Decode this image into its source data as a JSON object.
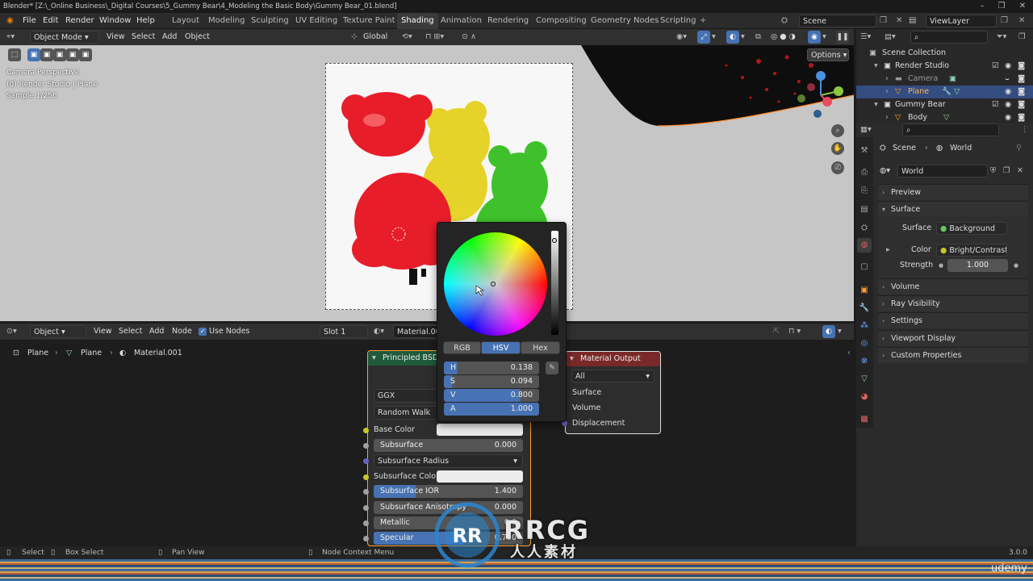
{
  "titlebar": {
    "text": "Blender* [Z:\\_Online Business\\_Digital Courses\\5_Gummy Bear\\4_Modeling the Basic Body\\Gummy Bear_01.blend]"
  },
  "menu": {
    "file": "File",
    "edit": "Edit",
    "render": "Render",
    "window": "Window",
    "help": "Help"
  },
  "workspaces": [
    "Layout",
    "Modeling",
    "Sculpting",
    "UV Editing",
    "Texture Paint",
    "Shading",
    "Animation",
    "Rendering",
    "Compositing",
    "Geometry Nodes",
    "Scripting"
  ],
  "scene": {
    "scene_name": "Scene",
    "view_layer": "ViewLayer"
  },
  "viewport_header": {
    "mode": "Object Mode",
    "view": "View",
    "select": "Select",
    "add": "Add",
    "object": "Object",
    "orientation": "Global",
    "options": "Options"
  },
  "viewport_overlay": {
    "line1": "Camera Perspective",
    "line2": "(0) Render Studio | Plane",
    "line3": "Sample 1/256"
  },
  "node_header": {
    "type": "Object",
    "view": "View",
    "select": "Select",
    "add": "Add",
    "node": "Node",
    "use_nodes": "Use Nodes",
    "slot": "Slot 1",
    "material": "Material.001"
  },
  "breadcrumb": {
    "obj": "Plane",
    "mesh": "Plane",
    "mat": "Material.001"
  },
  "bsdf": {
    "title": "Principled BSDF",
    "dist": "GGX",
    "sss": "Random Walk",
    "props": [
      {
        "label": "Base Color"
      },
      {
        "label": "Subsurface",
        "value": "0.000"
      },
      {
        "label": "Subsurface Radius"
      },
      {
        "label": "Subsurface Color"
      },
      {
        "label": "Subsurface IOR",
        "value": "1.400"
      },
      {
        "label": "Subsurface Anisotropy",
        "value": "0.000"
      },
      {
        "label": "Metallic",
        "value": "0.0"
      },
      {
        "label": "Specular",
        "value": "0.750"
      }
    ]
  },
  "output_node": {
    "title": "Material Output",
    "target": "All",
    "surface": "Surface",
    "volume": "Volume",
    "displacement": "Displacement"
  },
  "picker": {
    "tabs": [
      "RGB",
      "HSV",
      "Hex"
    ],
    "fields": [
      {
        "label": "H",
        "value": "0.138"
      },
      {
        "label": "S",
        "value": "0.094"
      },
      {
        "label": "V",
        "value": "0.800"
      },
      {
        "label": "A",
        "value": "1.000"
      }
    ]
  },
  "outliner": {
    "title": "Scene Collection",
    "items": [
      "Render Studio",
      "Camera",
      "Plane",
      "Gummy Bear",
      "Body"
    ]
  },
  "properties": {
    "scene": "Scene",
    "world": "World",
    "world_name": "World",
    "preview": "Preview",
    "surface": "Surface",
    "surface_label": "Surface",
    "surface_value": "Background",
    "color_label": "Color",
    "color_value": "Bright/Contrast",
    "strength_label": "Strength",
    "strength_value": "1.000",
    "panels": [
      "Volume",
      "Ray Visibility",
      "Settings",
      "Viewport Display",
      "Custom Properties"
    ]
  },
  "statusbar": {
    "select": "Select",
    "box_select": "Box Select",
    "pan_view": "Pan View",
    "context_menu": "Node Context Menu",
    "version": "3.0.0"
  },
  "watermark": {
    "text": "RRCG",
    "sub": "人人素材",
    "udemy": "udemy"
  },
  "colors": {
    "accent": "#4772b3",
    "node_header_red": "#7a2929",
    "node_header_green": "#1f5a3a",
    "selection": "#ffa033"
  }
}
